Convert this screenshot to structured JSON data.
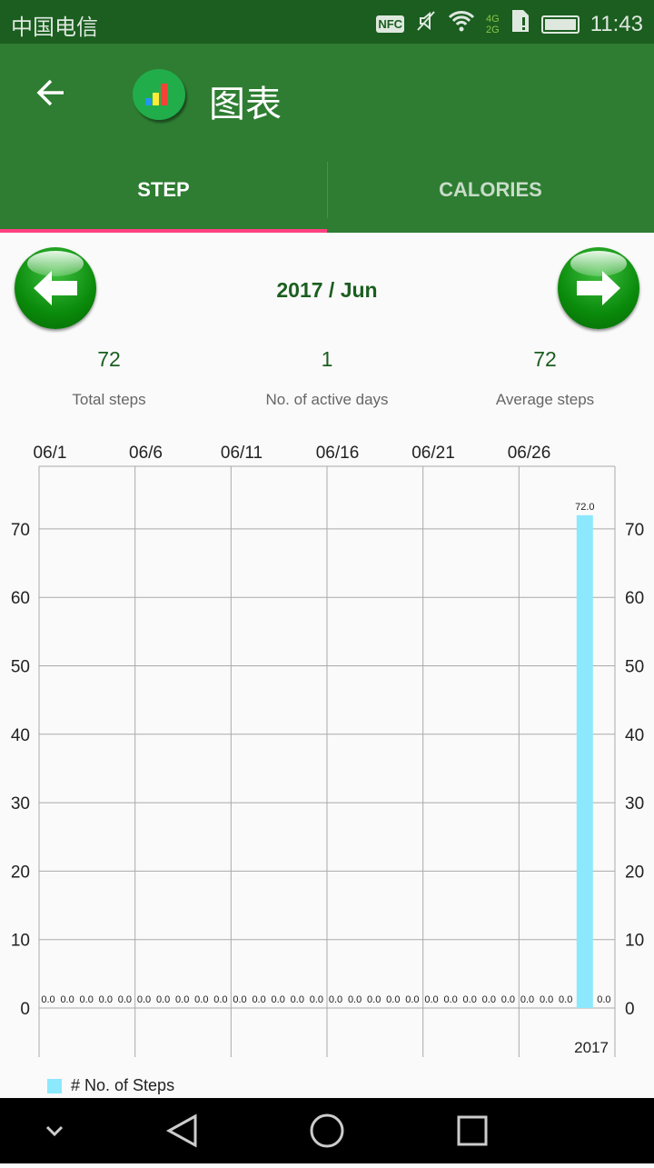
{
  "status": {
    "carrier": "中国电信",
    "time": "11:43",
    "nfc": "NFC",
    "net_top": "4G",
    "net_bottom": "2G",
    "icons": [
      "nfc-icon",
      "mute-icon",
      "wifi-icon",
      "signal-icon",
      "sim-alert-icon",
      "battery-icon"
    ]
  },
  "appbar": {
    "title": "图表",
    "back_icon": "arrow-left-icon",
    "logo_icon": "bar-chart-logo"
  },
  "tabs": [
    {
      "label": "STEP",
      "active": true
    },
    {
      "label": "CALORIES",
      "active": false
    }
  ],
  "colors": {
    "status": "#1b5e20",
    "appbar": "#2e7d32",
    "indicator": "#ff4081",
    "bar": "#8ce8fc",
    "text_green": "#1b5e20"
  },
  "month": "2017 / Jun",
  "stats": [
    {
      "value": "72",
      "label": "Total steps"
    },
    {
      "value": "1",
      "label": "No. of active days"
    },
    {
      "value": "72",
      "label": "Average steps"
    }
  ],
  "chart_data": {
    "type": "bar",
    "x_ticks": [
      "06/1",
      "06/6",
      "06/11",
      "06/16",
      "06/21",
      "06/26"
    ],
    "x_sublabel": "2017",
    "categories": [
      "06/1",
      "06/2",
      "06/3",
      "06/4",
      "06/5",
      "06/6",
      "06/7",
      "06/8",
      "06/9",
      "06/10",
      "06/11",
      "06/12",
      "06/13",
      "06/14",
      "06/15",
      "06/16",
      "06/17",
      "06/18",
      "06/19",
      "06/20",
      "06/21",
      "06/22",
      "06/23",
      "06/24",
      "06/25",
      "06/26",
      "06/27",
      "06/28",
      "06/29",
      "06/30"
    ],
    "series": [
      {
        "values": [
          0,
          0,
          0,
          0,
          0,
          0,
          0,
          0,
          0,
          0,
          0,
          0,
          0,
          0,
          0,
          0,
          0,
          0,
          0,
          0,
          0,
          0,
          0,
          0,
          0,
          0,
          0,
          0,
          72,
          0
        ]
      }
    ],
    "y_ticks": [
      0,
      10,
      20,
      30,
      40,
      50,
      60,
      70
    ],
    "ylim": [
      -7,
      79
    ],
    "grid": true,
    "legend": "bottom-left"
  },
  "legend_label": "# No. of Steps",
  "nav": {
    "icons": [
      "hide-keyboard-icon",
      "back-icon",
      "home-icon",
      "recents-icon"
    ]
  }
}
